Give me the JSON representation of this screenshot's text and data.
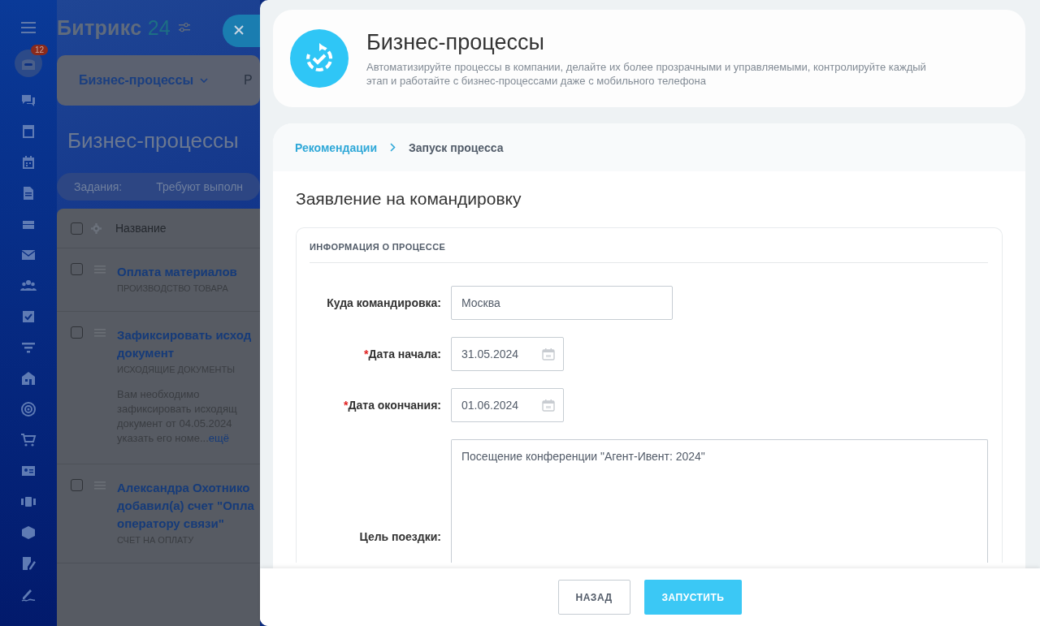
{
  "background_page": {
    "logo": {
      "name": "Битрикс",
      "number": "24"
    },
    "notification_count": "12",
    "tabs": [
      {
        "label": "Бизнес-процессы",
        "selected": true
      },
      {
        "label": "Р",
        "selected": false
      }
    ],
    "title": "Бизнес-процессы",
    "filter": {
      "label": "Задания:",
      "value": "Требуют выполн"
    },
    "table": {
      "columns": [
        "Название"
      ],
      "all_checked": false,
      "rows": [
        {
          "checked": false,
          "title_lines": [
            "Оплата материалов"
          ],
          "category": "ПРОИЗВОДСТВО ТОВАРА"
        },
        {
          "checked": false,
          "title_lines": [
            "Зафиксировать исход",
            "документ"
          ],
          "category": "ИСХОДЯЩИЕ ДОКУМЕНТЫ",
          "description_lines": [
            "Вам необходимо",
            "зафиксировать исходящ",
            "документ от 04.05.2024",
            "указать его номе..."
          ],
          "more": "ещё"
        },
        {
          "checked": false,
          "title_lines": [
            "Александра Охотнико",
            "добавил(а) счет \"Опла",
            "оператору связи\""
          ],
          "category": "СЧЕТ НА ОПЛАТУ"
        }
      ]
    }
  },
  "slider": {
    "header": {
      "title": "Бизнес-процессы",
      "description": "Автоматизируйте процессы в компании, делайте их более прозрачными и управляемыми, контролируйте каждый этап и работайте с бизнес-процессами даже с мобильного телефона"
    },
    "breadcrumbs": [
      {
        "label": "Рекомендации",
        "kind": "link"
      },
      {
        "label": "Запуск процесса",
        "kind": "current"
      }
    ],
    "form": {
      "title": "Заявление на командировку",
      "section": "ИНФОРМАЦИЯ О ПРОЦЕССЕ",
      "fields": [
        {
          "label": "Куда командировка:",
          "kind": "text",
          "value": "Москва"
        },
        {
          "label": "Дата начала:",
          "required_mark": "*",
          "kind": "date",
          "value": "31.05.2024"
        },
        {
          "label": "Дата окончания:",
          "required_mark": "*",
          "kind": "date",
          "value": "01.06.2024"
        },
        {
          "label": "Цель поездки:",
          "kind": "textarea",
          "value": "Посещение конференции \"Агент-Ивент: 2024\""
        }
      ]
    },
    "buttons": [
      {
        "label": "НАЗАД",
        "kind": "secondary"
      },
      {
        "label": "ЗАПУСТИТЬ",
        "kind": "primary"
      }
    ]
  }
}
